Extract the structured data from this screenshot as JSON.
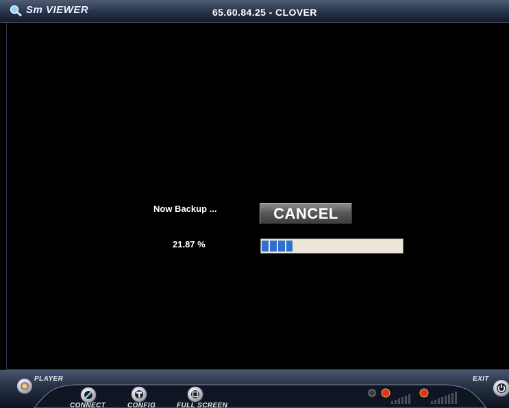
{
  "titlebar": {
    "app_name": "Sm VIEWER",
    "connection": "65.60.84.25  -  CLOVER"
  },
  "backup": {
    "status_label": "Now Backup ...",
    "cancel_label": "CANCEL",
    "percent_text": "21.87 %",
    "progress_fraction": 0.2187
  },
  "toolbar": {
    "player_label": "PLAYER",
    "exit_label": "EXIT",
    "connect_label": "CONNECT",
    "config_label": "CONFIG",
    "fullscreen_label": "FULL SCREEN"
  },
  "icons": {
    "app": "magnifier-icon",
    "player": "player-icon",
    "connect": "compass-icon",
    "config": "hammer-icon",
    "fullscreen": "fullscreen-icon",
    "exit": "power-icon",
    "mic": "microphone-icon",
    "speaker": "speaker-icon"
  },
  "colors": {
    "progress": "#2f6fd1",
    "progress_track": "#ebe6d8",
    "titlebar": "#27344a"
  }
}
